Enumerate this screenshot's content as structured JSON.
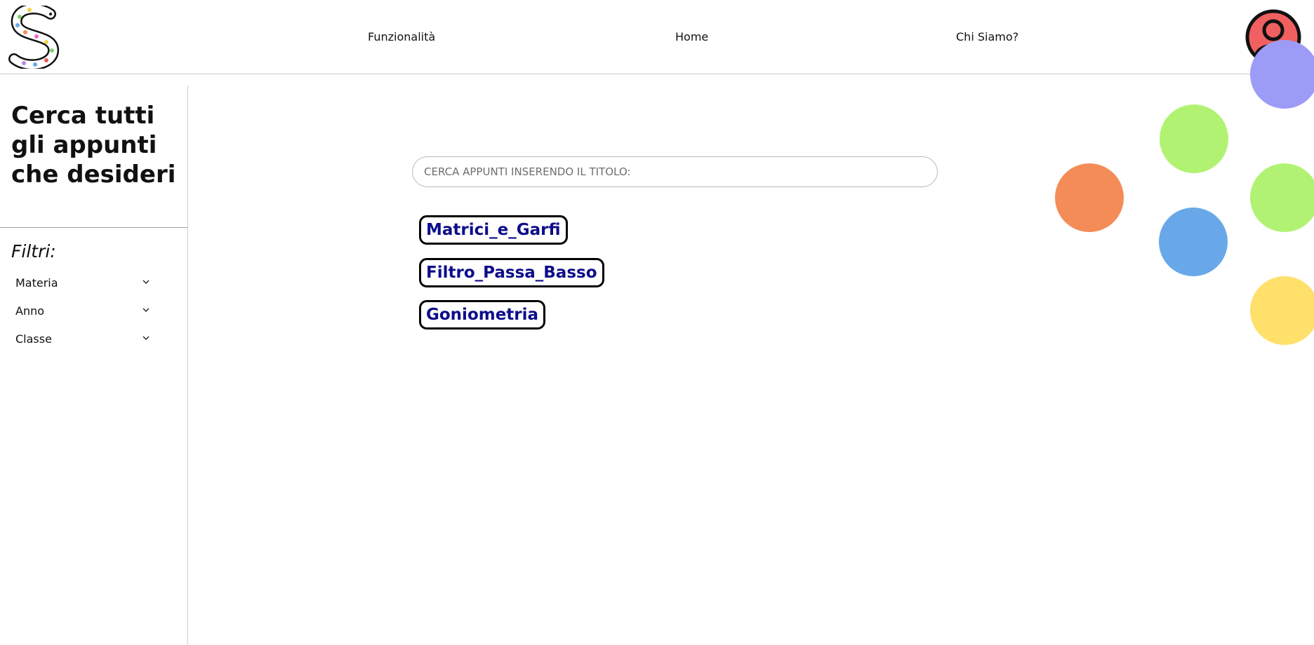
{
  "header": {
    "logo_icon": "snake-s-logo",
    "nav": [
      {
        "label": "Funzionalità"
      },
      {
        "label": "Home"
      },
      {
        "label": "Chi Siamo?"
      }
    ],
    "avatar_icon": "user-avatar-icon",
    "avatar_color": "#f06060"
  },
  "sidebar": {
    "title": "Cerca tutti gli appunti che desideri",
    "filters_label": "Filtri:",
    "filters": [
      {
        "label": "Materia",
        "icon": "chevron-down-icon"
      },
      {
        "label": "Anno",
        "icon": "chevron-down-icon"
      },
      {
        "label": "Classe",
        "icon": "chevron-down-icon"
      }
    ]
  },
  "search": {
    "placeholder": "CERCA APPUNTI INSERENDO IL TITOLO:",
    "value": ""
  },
  "results": [
    {
      "title": "Matrici_e_Garfi"
    },
    {
      "title": "Filtro_Passa_Basso"
    },
    {
      "title": "Goniometria"
    }
  ],
  "colors": {
    "result_text": "#0d0d8a",
    "circle_purple": "#9c9cf7",
    "circle_green": "#b2f272",
    "circle_orange": "#f48c58",
    "circle_blue": "#68a8e8",
    "circle_yellow": "#ffe06a"
  }
}
